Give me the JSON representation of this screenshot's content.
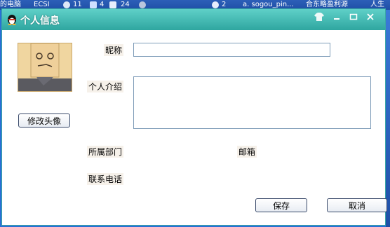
{
  "background": {
    "taskbar_texts": [
      "的电脑",
      "ECSI",
      "11",
      "4",
      "24",
      "2",
      "a. sogou_pin...",
      "合东略盈利源",
      "人生"
    ]
  },
  "window": {
    "title": "个人信息",
    "titlebar_buttons": [
      "shirt-icon",
      "minimize-icon",
      "maximize-icon",
      "close-icon"
    ]
  },
  "form": {
    "nickname_label": "昵称",
    "nickname_value": "",
    "intro_label": "个人介绍",
    "intro_value": "",
    "department_label": "所属部门",
    "email_label": "邮箱",
    "phone_label": "联系电话"
  },
  "avatar": {
    "change_label": "修改头像"
  },
  "actions": {
    "save_label": "保存",
    "cancel_label": "取消"
  },
  "colors": {
    "titlebar": "#2fa6a0",
    "border": "#3aa7a5"
  }
}
